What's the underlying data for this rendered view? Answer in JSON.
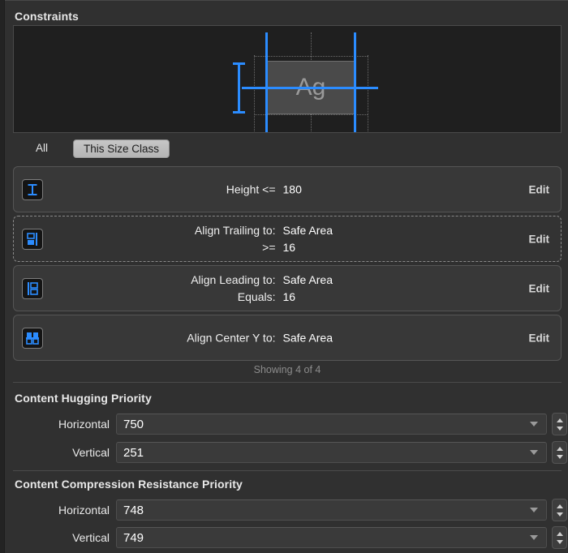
{
  "header": {
    "title": "Constraints"
  },
  "preview": {
    "placeholder_text": "Ag",
    "guide_color": "#2b8cff",
    "box_color": "#4a4a4a"
  },
  "size_class": {
    "all_label": "All",
    "selected_label": "This Size Class"
  },
  "constraints": {
    "edit_label": "Edit",
    "showing_label": "Showing 4 of 4",
    "rows": [
      {
        "icon": "height-constraint-icon",
        "style": "solid",
        "lines": [
          {
            "label": "Height <=",
            "value": "180"
          }
        ]
      },
      {
        "icon": "align-trailing-icon",
        "style": "dashed",
        "lines": [
          {
            "label": "Align Trailing to:",
            "value": "Safe Area"
          },
          {
            "label": ">=",
            "value": "16"
          }
        ]
      },
      {
        "icon": "align-leading-icon",
        "style": "solid",
        "lines": [
          {
            "label": "Align Leading to:",
            "value": "Safe Area"
          },
          {
            "label": "Equals:",
            "value": "16"
          }
        ]
      },
      {
        "icon": "align-center-y-icon",
        "style": "solid",
        "lines": [
          {
            "label": "Align Center Y to:",
            "value": "Safe Area"
          }
        ]
      }
    ]
  },
  "content_hugging": {
    "title": "Content Hugging Priority",
    "fields": [
      {
        "label": "Horizontal",
        "value": "750"
      },
      {
        "label": "Vertical",
        "value": "251"
      }
    ]
  },
  "content_compression": {
    "title": "Content Compression Resistance Priority",
    "fields": [
      {
        "label": "Horizontal",
        "value": "748"
      },
      {
        "label": "Vertical",
        "value": "749"
      }
    ]
  }
}
